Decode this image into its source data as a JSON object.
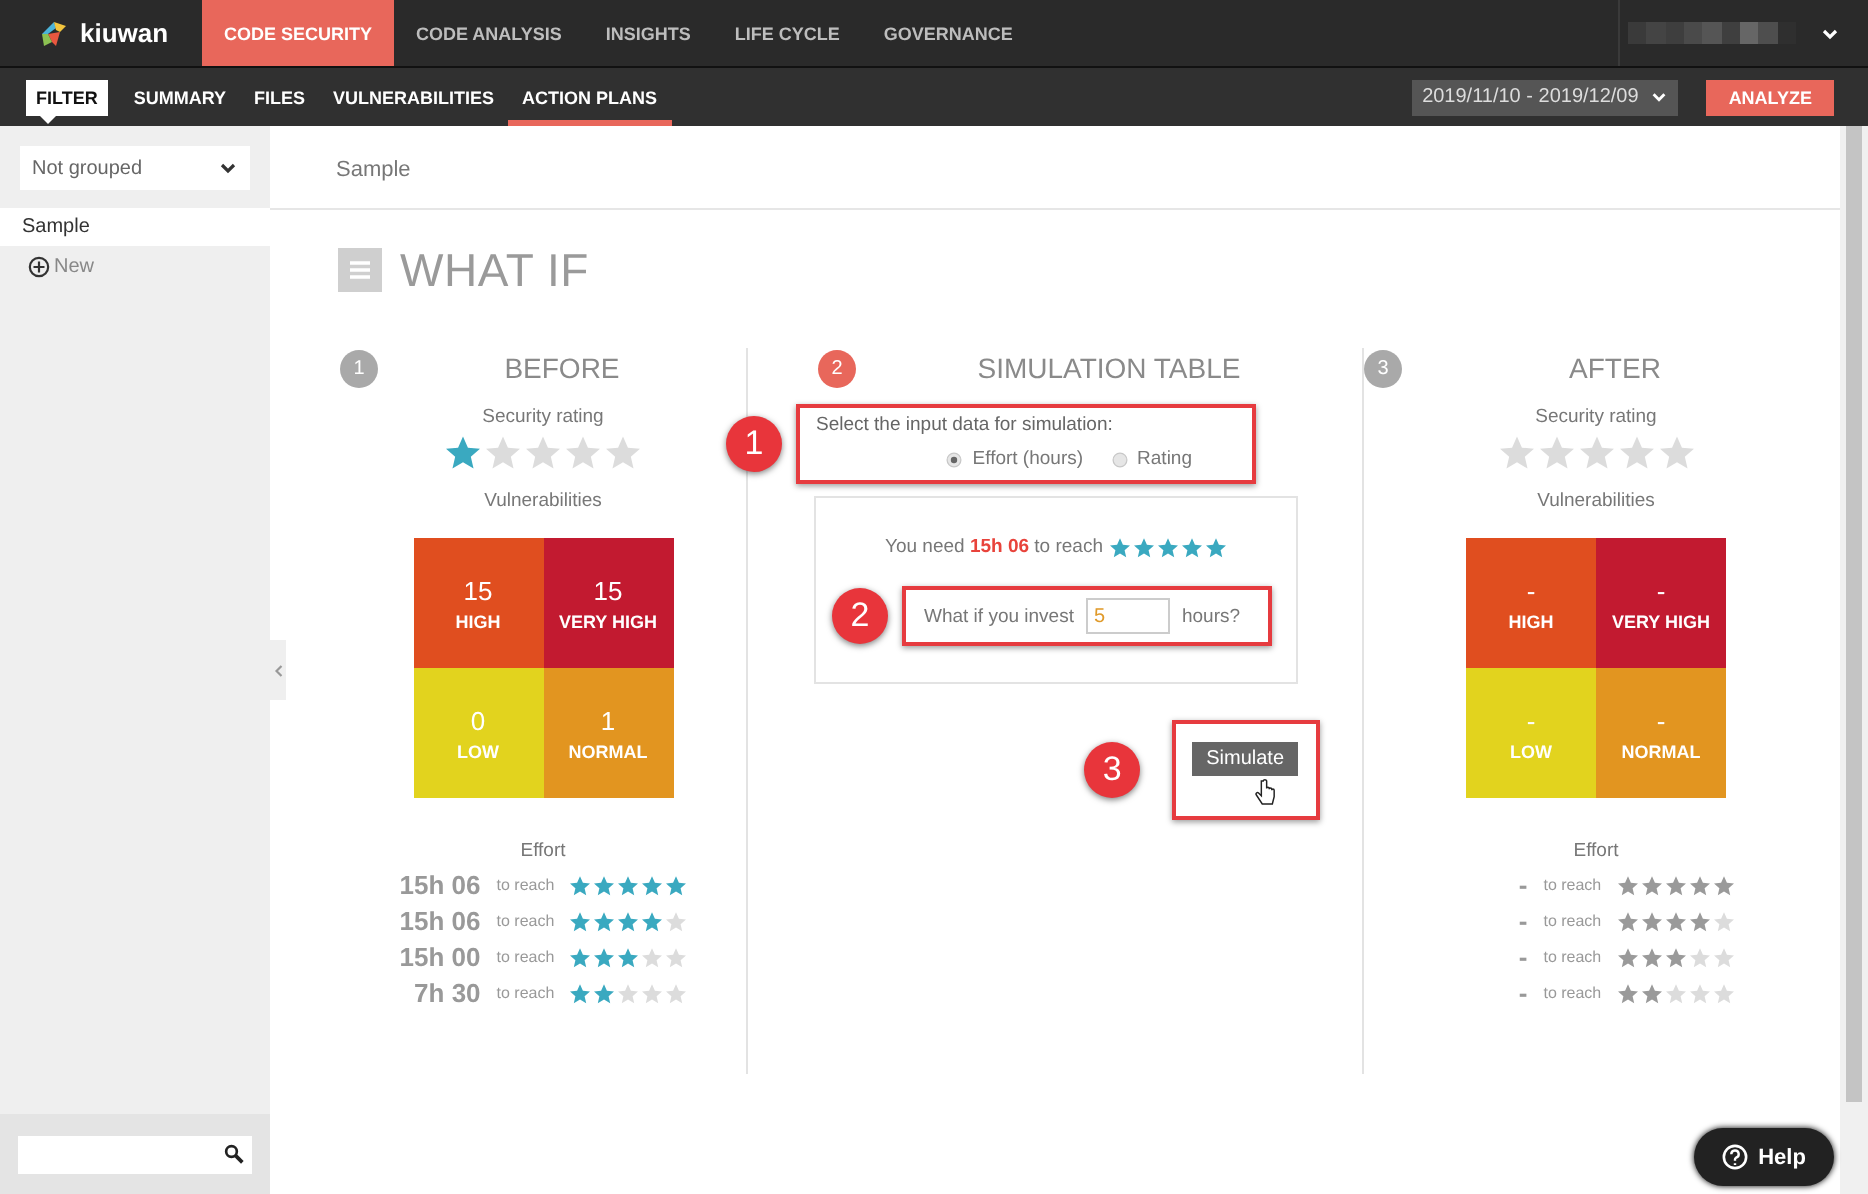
{
  "logo": {
    "text": "kiuwan"
  },
  "top_nav": [
    {
      "label": "CODE SECURITY",
      "selected": true
    },
    {
      "label": "CODE ANALYSIS",
      "selected": false
    },
    {
      "label": "INSIGHTS",
      "selected": false
    },
    {
      "label": "LIFE CYCLE",
      "selected": false
    },
    {
      "label": "GOVERNANCE",
      "selected": false
    }
  ],
  "filter_button": {
    "label": "FILTER"
  },
  "sub_nav": [
    {
      "label": "SUMMARY",
      "selected": false
    },
    {
      "label": "FILES",
      "selected": false
    },
    {
      "label": "VULNERABILITIES",
      "selected": false
    },
    {
      "label": "ACTION PLANS",
      "selected": true
    }
  ],
  "date_range": "2019/11/10 - 2019/12/09",
  "analyze_button": "ANALYZE",
  "sidebar": {
    "group_select": "Not grouped",
    "items": [
      {
        "label": "Sample",
        "selected": true
      }
    ],
    "new_link": "New"
  },
  "breadcrumb": "Sample",
  "page_title": "WHAT IF",
  "before": {
    "kind": "before",
    "step": "1",
    "title": "BEFORE",
    "rating_label": "Security rating",
    "stars": 1,
    "vuln_label": "Vulnerabilities",
    "cells": [
      {
        "value": "15",
        "label": "HIGH",
        "color": "#e04e1f"
      },
      {
        "value": "15",
        "label": "VERY HIGH",
        "color": "#c21a30"
      },
      {
        "value": "0",
        "label": "LOW",
        "color": "#e2d31e"
      },
      {
        "value": "1",
        "label": "NORMAL",
        "color": "#e29520"
      }
    ],
    "effort_label": "Effort",
    "effort_rows": [
      {
        "time": "15h 06",
        "to_reach": "to reach",
        "stars": 5
      },
      {
        "time": "15h 06",
        "to_reach": "to reach",
        "stars": 4
      },
      {
        "time": "15h 00",
        "to_reach": "to reach",
        "stars": 3
      },
      {
        "time": "7h 30",
        "to_reach": "to reach",
        "stars": 2
      }
    ]
  },
  "simulation": {
    "step": "2",
    "title": "SIMULATION TABLE",
    "prompt": "Select the input data for simulation:",
    "prompt_callout": "1",
    "options": [
      {
        "label": "Effort (hours)",
        "selected": true
      },
      {
        "label": "Rating",
        "selected": false
      }
    ],
    "need": {
      "text": "You need **15h 06** to reach",
      "stars": 5
    },
    "invest_label": "What if you invest",
    "invest_value": "5",
    "invest_unit": "hours?",
    "invest_callout": "2",
    "simulate_button": "Simulate",
    "simulate_callout": "3"
  },
  "after": {
    "kind": "after",
    "step": "3",
    "title": "AFTER",
    "rating_label": "Security rating",
    "stars": 0,
    "vuln_label": "Vulnerabilities",
    "cells": [
      {
        "value": "-",
        "label": "HIGH",
        "color": "#e04e1f"
      },
      {
        "value": "-",
        "label": "VERY HIGH",
        "color": "#c21a30"
      },
      {
        "value": "-",
        "label": "LOW",
        "color": "#e2d31e"
      },
      {
        "value": "-",
        "label": "NORMAL",
        "color": "#e29520"
      }
    ],
    "effort_label": "Effort",
    "effort_rows": [
      {
        "time": "-",
        "to_reach": "to reach",
        "stars": 5
      },
      {
        "time": "-",
        "to_reach": "to reach",
        "stars": 4
      },
      {
        "time": "-",
        "to_reach": "to reach",
        "stars": 3
      },
      {
        "time": "-",
        "to_reach": "to reach",
        "stars": 2
      }
    ]
  },
  "help_button": "Help"
}
